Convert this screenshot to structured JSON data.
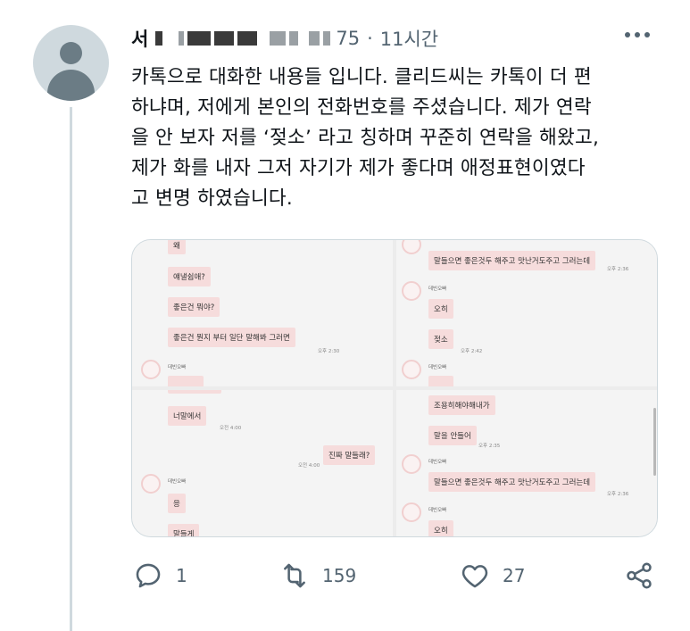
{
  "tweet": {
    "author_name": "서",
    "handle_tail": "75",
    "separator": "·",
    "time": "11시간",
    "text": "카톡으로 대화한 내용들 입니다. 클리드씨는 카톡이 더 편하냐며, 저에게 본인의 전화번호를 주셨습니다. 제가 연락을 안 보자 저를 ‘젖소’ 라고 칭하며 꾸준히 연락을 해왔고, 제가 화를 내자 그저 자기가 제가 좋다며 애정표현이였다고 변명 하였습니다.",
    "text_lines": [
      "카톡으로 대화한 내용들 입니다. 클리드씨는 카톡이 더 편",
      "하냐며, 저에게 본인의 전화번호를 주셨습니다. 제가 연락",
      "을 안 보자 저를 ‘젖소’ 라고 칭하며 꾸준히 연락을 해왔고,",
      "제가 화를 내자 그저 자기가 제가 좋다며 애정표현이였다",
      "고 변명 하였습니다."
    ]
  },
  "chat_screens": {
    "panel1": {
      "top": "왜",
      "bubbles": [
        "얘낼쉼애?",
        "좋은건 뭐야?",
        "좋은건 뭔지 부터 일단 말해봐 그러면"
      ],
      "stamp": "오후 2:30",
      "sender": "데빈오빠"
    },
    "panel2": {
      "bubble_top": "말들으면 좋은것두 해주고 맛난거도주고 그러는데",
      "stamp_top": "오후 2:36",
      "sender": "데빈오빠",
      "bubbles": [
        "오히",
        "젖소"
      ],
      "stamp": "오후 2:42",
      "sender2": "데빈오빠"
    },
    "panel3": {
      "bubble_a": "너말에서",
      "stamp_a": "오전 4:00",
      "bubble_b": "진짜 말들래?",
      "stamp_b": "오전 4:00",
      "sender": "데빈오빠",
      "bubble_c": "응",
      "bubble_d": "말들게"
    },
    "panel4": {
      "bubble_a": "조용히해야해내가",
      "bubble_b": "말을 안들어",
      "stamp_b": "오후 2:35",
      "sender": "데빈오빠",
      "bubble_c": "말들으면 좋은것두 해주고 맛난거도주고 그러는데",
      "stamp_c": "오후 2:36",
      "sender2": "데빈오빠",
      "bubble_d": "오히"
    }
  },
  "actions": {
    "reply_count": "1",
    "retweet_count": "159",
    "like_count": "27"
  },
  "icons": {
    "reply": "reply-icon",
    "retweet": "retweet-icon",
    "like": "heart-icon",
    "share": "share-icon",
    "more": "more-icon"
  },
  "colors": {
    "text": "#0f1419",
    "secondary": "#536471",
    "border": "#cfd9de",
    "bubble": "#f6dcdc"
  }
}
